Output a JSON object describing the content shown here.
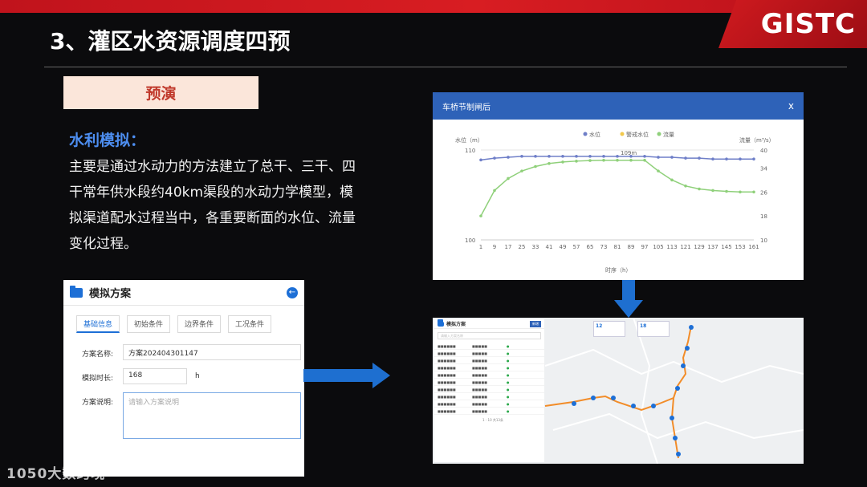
{
  "header": {
    "title": "3、灌区水资源调度四预",
    "logo": "GISTC"
  },
  "section_tag": "预演",
  "sub_heading": "水利模拟：",
  "body_text": "主要是通过水动力的方法建立了总干、三干、四干常年供水段约40km渠段的水动力学模型，模拟渠道配水过程当中，各重要断面的水位、流量变化过程。",
  "form": {
    "title": "模拟方案",
    "tabs": [
      "基础信息",
      "初始条件",
      "边界条件",
      "工况条件"
    ],
    "name_label": "方案名称:",
    "name_value": "方案202404301147",
    "duration_label": "模拟时长:",
    "duration_value": "168",
    "duration_unit": "h",
    "desc_label": "方案说明:",
    "desc_placeholder": "请输入方案说明"
  },
  "chart_window": {
    "title": "车桥节制闸后",
    "close": "x"
  },
  "chart_data": {
    "type": "line",
    "legend": [
      "水位",
      "警戒水位",
      "流量"
    ],
    "ylabel_left": "水位（m）",
    "ylabel_right": "流量（m³/s）",
    "xlabel": "时序（h）",
    "y_left_range": [
      100,
      110
    ],
    "y_right_range": [
      10,
      40
    ],
    "y_left_ticks": [
      "110",
      "100"
    ],
    "y_right_ticks": [
      "40",
      "34",
      "26",
      "18",
      "10"
    ],
    "x_ticks": [
      "1",
      "9",
      "17",
      "25",
      "33",
      "41",
      "49",
      "57",
      "65",
      "73",
      "81",
      "89",
      "97",
      "105",
      "113",
      "121",
      "129",
      "137",
      "145",
      "153",
      "161"
    ],
    "annotation": "109m",
    "series": [
      {
        "name": "水位",
        "color": "#6f7fc8",
        "values": [
          108.9,
          109.1,
          109.2,
          109.3,
          109.3,
          109.3,
          109.3,
          109.3,
          109.3,
          109.3,
          109.3,
          109.3,
          109.3,
          109.2,
          109.2,
          109.1,
          109.1,
          109.0,
          109.0,
          109.0,
          109.0
        ]
      },
      {
        "name": "流量",
        "color": "#8fd07a",
        "values": [
          18.0,
          26.5,
          30.5,
          33.0,
          34.5,
          35.5,
          36.0,
          36.3,
          36.5,
          36.6,
          36.6,
          36.6,
          36.6,
          33.0,
          30.0,
          28.0,
          27.0,
          26.5,
          26.2,
          26.0,
          26.0
        ]
      }
    ]
  },
  "map_window": {
    "list_title": "模拟方案",
    "list_btn": "新增",
    "search_placeholder": "请输入方案名称",
    "stat1": "12",
    "stat2": "18",
    "pager": "1 - 10 共13条"
  },
  "watermark": "1050大数跨境"
}
